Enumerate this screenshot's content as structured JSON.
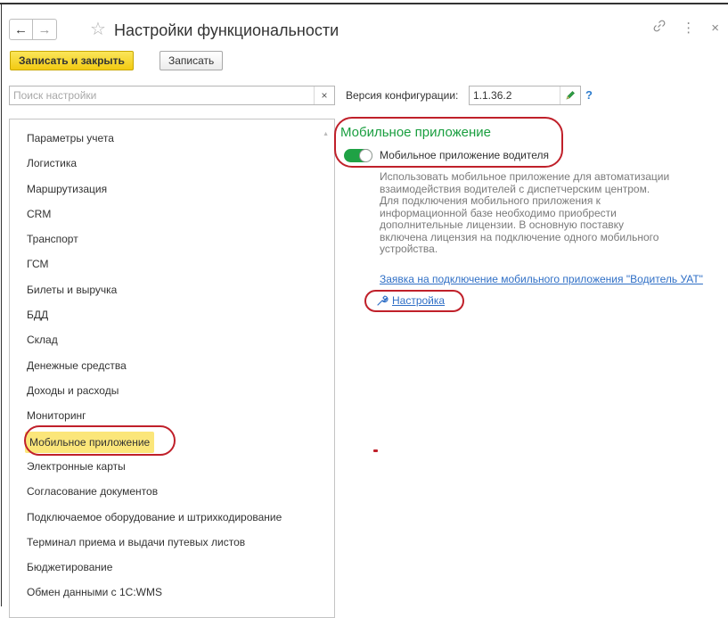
{
  "window": {
    "title": "Настройки функциональности",
    "back_icon": "←",
    "forward_icon": "→",
    "star_icon": "☆",
    "link_icon": "🔗",
    "more_icon": "⋮",
    "close_icon": "×"
  },
  "toolbar": {
    "save_close_label": "Записать и закрыть",
    "save_label": "Записать"
  },
  "search": {
    "placeholder": "Поиск настройки",
    "value": "",
    "clear_icon": "×"
  },
  "version": {
    "label": "Версия конфигурации:",
    "value": "1.1.36.2",
    "help": "?"
  },
  "sections": {
    "items": [
      "Параметры учета",
      "Логистика",
      "Маршрутизация",
      "CRM",
      "Транспорт",
      "ГСМ",
      "Билеты и выручка",
      "БДД",
      "Склад",
      "Денежные средства",
      "Доходы и расходы",
      "Мониторинг",
      "Мобильное приложение",
      "Электронные карты",
      "Согласование документов",
      "Подключаемое оборудование и штрихкодирование",
      "Терминал приема и выдачи путевых листов",
      "Бюджетирование",
      "Обмен данными с 1С:WMS"
    ],
    "selected": "Мобильное приложение"
  },
  "panel": {
    "title": "Мобильное приложение",
    "toggle_label": "Мобильное приложение водителя",
    "toggle_on": true,
    "description_lines": [
      "Использовать мобильное приложение для автоматизации",
      "взаимодействия водителей с диспетчерским центром.",
      "Для подключения мобильного приложения к",
      "информационной базе необходимо приобрести",
      "дополнительные лицензии. В основную поставку",
      "включена лицензия на подключение одного мобильного",
      "устройства."
    ],
    "request_link": "Заявка на подключение мобильного приложения \"Водитель УАТ\"",
    "settings_link": "Настройка"
  },
  "colors": {
    "accent_green": "#199e3f",
    "primary_button": "#f2ca12",
    "selected_row": "#fbe67a",
    "highlight_red": "#c0202a",
    "link_blue": "#2f6fc6"
  }
}
